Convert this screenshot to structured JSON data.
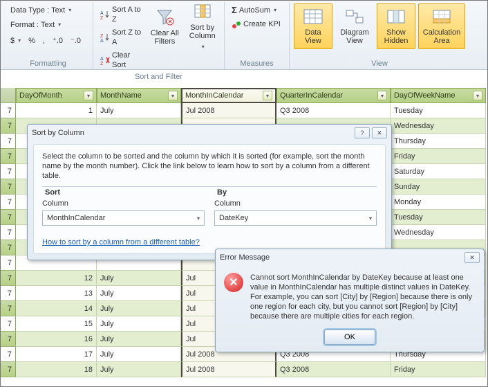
{
  "ribbon": {
    "groups": {
      "formatting": {
        "title": "Formatting",
        "dataTypeLabel": "Data Type :",
        "dataTypeValue": "Text",
        "formatLabel": "Format :",
        "formatValue": "Text",
        "currency": "$",
        "percent": "%",
        "comma": ",",
        "incDec": ".0⁰",
        "decDec": ".0₁"
      },
      "sortFilter": {
        "title": "Sort and Filter",
        "sortAZ": "Sort A to Z",
        "sortZA": "Sort Z to A",
        "clearSort": "Clear Sort",
        "clearAll": "Clear All\nFilters",
        "sortByCol": "Sort by\nColumn"
      },
      "measures": {
        "title": "Measures",
        "autosum": "AutoSum",
        "createKpi": "Create KPI"
      },
      "view": {
        "title": "View",
        "dataView": "Data\nView",
        "diagramView": "Diagram\nView",
        "showHidden": "Show\nHidden",
        "calcArea": "Calculation\nArea"
      }
    }
  },
  "table": {
    "columns": [
      "DayOfMonth",
      "MonthName",
      "MonthInCalendar",
      "QuarterInCalendar",
      "DayOfWeekName"
    ],
    "selectedCol": 2,
    "rows": [
      {
        "dom": "1",
        "mon": "July",
        "mic": "Jul 2008",
        "qic": "Q3 2008",
        "dow": "Tuesday"
      },
      {
        "dom": "",
        "mon": "",
        "mic": "",
        "qic": "",
        "dow": "Wednesday"
      },
      {
        "dom": "",
        "mon": "",
        "mic": "",
        "qic": "",
        "dow": "Thursday"
      },
      {
        "dom": "",
        "mon": "",
        "mic": "",
        "qic": "",
        "dow": "Friday"
      },
      {
        "dom": "",
        "mon": "",
        "mic": "",
        "qic": "",
        "dow": "Saturday"
      },
      {
        "dom": "",
        "mon": "",
        "mic": "",
        "qic": "",
        "dow": "Sunday"
      },
      {
        "dom": "",
        "mon": "",
        "mic": "",
        "qic": "",
        "dow": "Monday"
      },
      {
        "dom": "",
        "mon": "",
        "mic": "",
        "qic": "",
        "dow": "Tuesday"
      },
      {
        "dom": "",
        "mon": "",
        "mic": "",
        "qic": "",
        "dow": "Wednesday"
      },
      {
        "dom": "",
        "mon": "",
        "mic": "",
        "qic": "",
        "dow": ""
      },
      {
        "dom": "",
        "mon": "",
        "mic": "",
        "qic": "",
        "dow": ""
      },
      {
        "dom": "12",
        "mon": "July",
        "mic": "Jul",
        "qic": "",
        "dow": ""
      },
      {
        "dom": "13",
        "mon": "July",
        "mic": "Jul",
        "qic": "",
        "dow": ""
      },
      {
        "dom": "14",
        "mon": "July",
        "mic": "Jul",
        "qic": "",
        "dow": ""
      },
      {
        "dom": "15",
        "mon": "July",
        "mic": "Jul",
        "qic": "",
        "dow": ""
      },
      {
        "dom": "16",
        "mon": "July",
        "mic": "Jul",
        "qic": "",
        "dow": ""
      },
      {
        "dom": "17",
        "mon": "July",
        "mic": "Jul 2008",
        "qic": "Q3 2008",
        "dow": "Thursday"
      },
      {
        "dom": "18",
        "mon": "July",
        "mic": "Jul 2008",
        "qic": "Q3 2008",
        "dow": "Friday"
      }
    ],
    "rowHead": "7"
  },
  "sortDialog": {
    "title": "Sort by Column",
    "intro": "Select the column to be sorted and the column by which it is sorted (for example, sort the month name by the month number). Click the link below to learn how to sort by a column from a different table.",
    "sortLegend": "Sort",
    "byLegend": "By",
    "columnLabel": "Column",
    "sortValue": "MonthInCalendar",
    "byValue": "DateKey",
    "link": "How to sort by a column from a different table?"
  },
  "errorDialog": {
    "title": "Error Message",
    "message": "Cannot sort MonthInCalendar by DateKey because at least one value in MonthInCalendar has multiple distinct values in DateKey. For example, you can sort [City] by [Region] because there is only one region for each city, but you cannot sort [Region] by [City] because there are multiple cities for each region.",
    "ok": "OK"
  }
}
